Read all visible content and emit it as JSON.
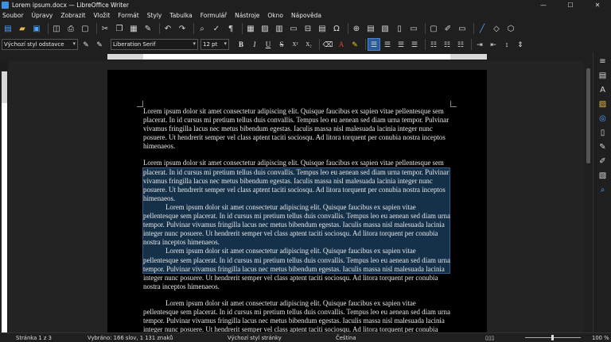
{
  "window": {
    "title": "Lorem ipsum.docx — LibreOffice Writer",
    "minimize": "—",
    "maximize": "☐",
    "close": "✕"
  },
  "menu": [
    "Soubor",
    "Úpravy",
    "Zobrazit",
    "Vložit",
    "Formát",
    "Styly",
    "Tabulka",
    "Formulář",
    "Nástroje",
    "Okno",
    "Nápověda"
  ],
  "format_bar": {
    "paragraph_style": "Výchozí styl odstavce",
    "font_name": "Liberation Serif",
    "font_size": "12 pt",
    "bold": "B",
    "italic": "I",
    "underline": "U",
    "strike": "S",
    "superscript": "X²",
    "subscript": "X₂"
  },
  "document": {
    "paragraphs": [
      "Lorem ipsum dolor sit amet consectetur adipiscing elit. Quisque faucibus ex sapien vitae pellentesque sem placerat. In id cursus mi pretium tellus duis convallis. Tempus leo eu aenean sed diam urna tempor. Pulvinar vivamus fringilla lacus nec metus bibendum egestas. Iaculis massa nisl malesuada lacinia integer nunc posuere. Ut hendrerit semper vel class aptent taciti sociosqu. Ad litora torquent per conubia nostra inceptos himenaeos.",
      "Lorem ipsum dolor sit amet consectetur adipiscing elit. Quisque faucibus ex sapien vitae pellentesque sem placerat. In id cursus mi pretium tellus duis convallis. Tempus leo eu aenean sed diam urna tempor. Pulvinar vivamus fringilla lacus nec metus bibendum egestas. Iaculis massa nisl malesuada lacinia integer nunc posuere. Ut hendrerit semper vel class aptent taciti sociosqu. Ad litora torquent per conubia nostra inceptos himenaeos.",
      "Lorem ipsum dolor sit amet consectetur adipiscing elit. Quisque faucibus ex sapien vitae pellentesque sem placerat. In id cursus mi pretium tellus duis convallis. Tempus leo eu aenean sed diam urna tempor. Pulvinar vivamus fringilla lacus nec metus bibendum egestas. Iaculis massa nisl malesuada lacinia integer nunc posuere. Ut hendrerit semper vel class aptent taciti sociosqu. Ad litora torquent per conubia nostra inceptos himenaeos.",
      "Lorem ipsum dolor sit amet consectetur adipiscing elit. Quisque faucibus ex sapien vitae pellentesque sem placerat. In id cursus mi pretium tellus duis convallis. Tempus leo eu aenean sed diam urna tempor. Pulvinar vivamus fringilla lacus nec metus bibendum egestas. Iaculis massa nisl malesuada lacinia integer nunc posuere. Ut hendrerit semper vel class aptent taciti sociosqu. Ad litora torquent per conubia nostra inceptos himenaeos.",
      "Lorem ipsum dolor sit amet consectetur adipiscing elit. Quisque faucibus ex sapien vitae pellentesque sem placerat. In id cursus mi pretium tellus duis convallis. Tempus leo eu aenean sed diam urna tempor. Pulvinar vivamus fringilla lacus nec metus bibendum egestas. Iaculis massa nisl malesuada lacinia integer nunc posuere. Ut hendrerit semper vel class aptent taciti sociosqu. Ad litora torquent per conubia nostra inceptos himenaeos."
    ]
  },
  "status": {
    "page": "Stránka 1 z 3",
    "selection": "Vybráno: 166 slov, 1 131 znaků",
    "page_style": "Výchozí styl stránky",
    "language": "Čeština",
    "zoom": "100 %"
  },
  "colors": {
    "selection": "#15314a",
    "accent": "#4ea3ff",
    "page": "#000000"
  }
}
